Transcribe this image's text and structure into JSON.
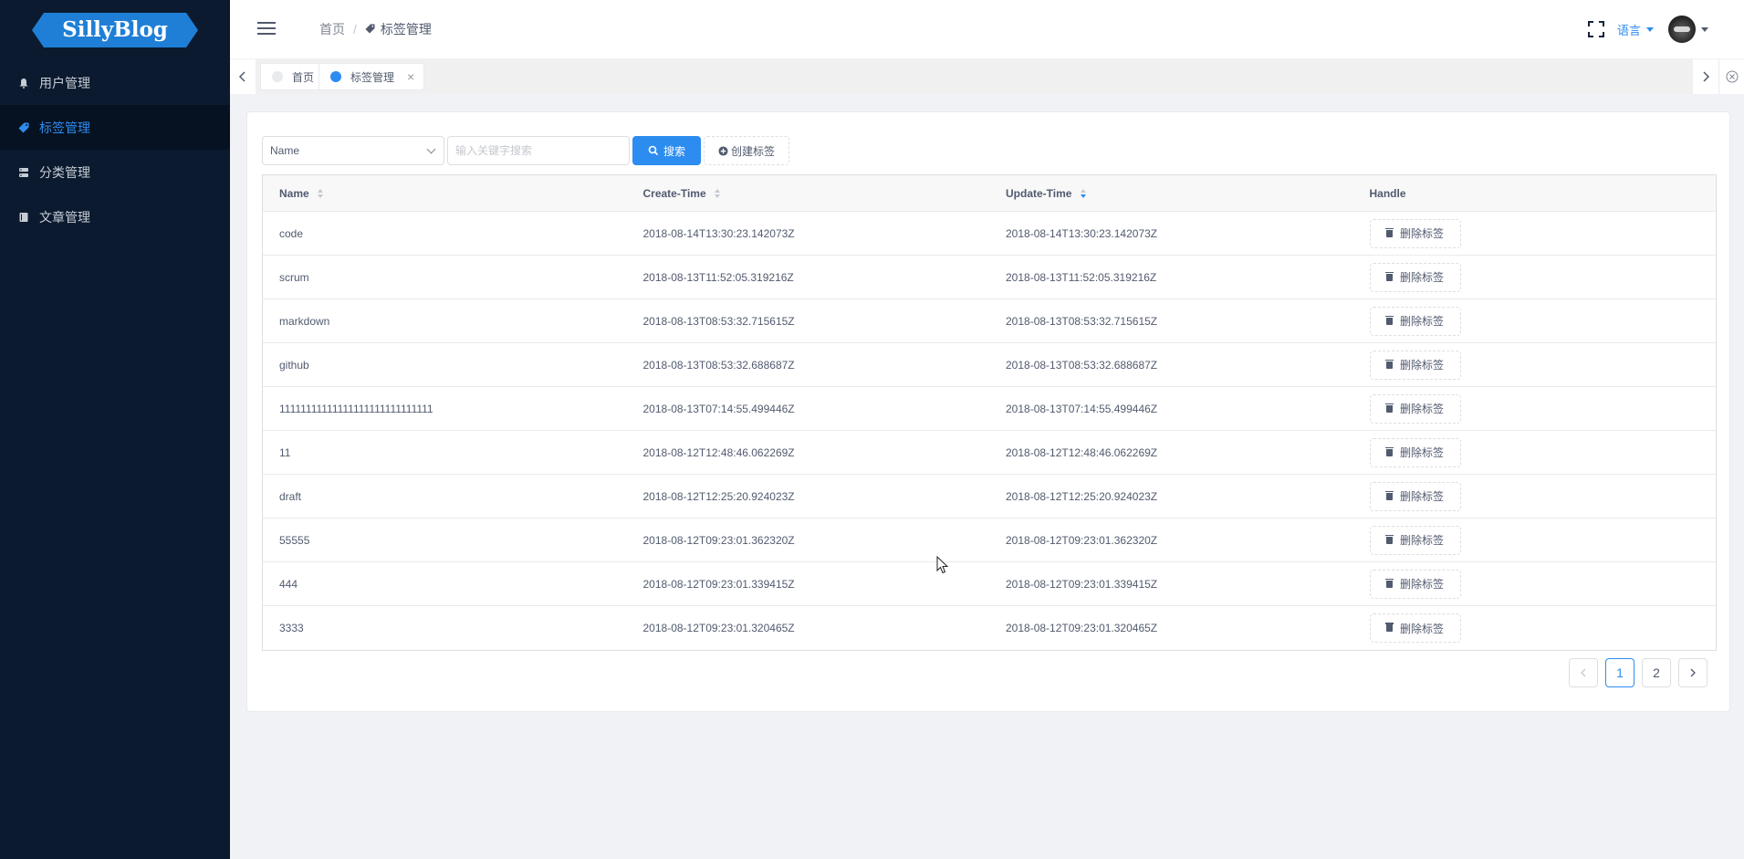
{
  "sidebar": {
    "logo": "SillyBlog",
    "items": [
      {
        "label": "用户管理",
        "icon": "bell-icon"
      },
      {
        "label": "标签管理",
        "icon": "tag-icon"
      },
      {
        "label": "分类管理",
        "icon": "category-icon"
      },
      {
        "label": "文章管理",
        "icon": "book-icon"
      }
    ]
  },
  "header": {
    "breadcrumb": {
      "home": "首页",
      "separator": "/",
      "current": "标签管理"
    },
    "language": "语言"
  },
  "tags": [
    {
      "label": "首页",
      "active": false
    },
    {
      "label": "标签管理",
      "active": true
    }
  ],
  "toolbar": {
    "select_value": "Name",
    "search_placeholder": "输入关键字搜索",
    "search_label": "搜索",
    "create_label": "创建标签"
  },
  "table": {
    "columns": [
      "Name",
      "Create-Time",
      "Update-Time",
      "Handle"
    ],
    "sort_active_column": "Update-Time",
    "delete_label": "删除标签",
    "rows": [
      {
        "name": "code",
        "create": "2018-08-14T13:30:23.142073Z",
        "update": "2018-08-14T13:30:23.142073Z"
      },
      {
        "name": "scrum",
        "create": "2018-08-13T11:52:05.319216Z",
        "update": "2018-08-13T11:52:05.319216Z"
      },
      {
        "name": "markdown",
        "create": "2018-08-13T08:53:32.715615Z",
        "update": "2018-08-13T08:53:32.715615Z"
      },
      {
        "name": "github",
        "create": "2018-08-13T08:53:32.688687Z",
        "update": "2018-08-13T08:53:32.688687Z"
      },
      {
        "name": "11111111111111111111111111111",
        "create": "2018-08-13T07:14:55.499446Z",
        "update": "2018-08-13T07:14:55.499446Z"
      },
      {
        "name": "11",
        "create": "2018-08-12T12:48:46.062269Z",
        "update": "2018-08-12T12:48:46.062269Z"
      },
      {
        "name": "draft",
        "create": "2018-08-12T12:25:20.924023Z",
        "update": "2018-08-12T12:25:20.924023Z"
      },
      {
        "name": "55555",
        "create": "2018-08-12T09:23:01.362320Z",
        "update": "2018-08-12T09:23:01.362320Z"
      },
      {
        "name": "444",
        "create": "2018-08-12T09:23:01.339415Z",
        "update": "2018-08-12T09:23:01.339415Z"
      },
      {
        "name": "3333",
        "create": "2018-08-12T09:23:01.320465Z",
        "update": "2018-08-12T09:23:01.320465Z"
      }
    ]
  },
  "pagination": {
    "pages": [
      "1",
      "2"
    ],
    "current": "1"
  },
  "colors": {
    "sidebar_bg": "#0b1a2e",
    "accent": "#2d8cf0",
    "active_item_bg": "#061222"
  }
}
